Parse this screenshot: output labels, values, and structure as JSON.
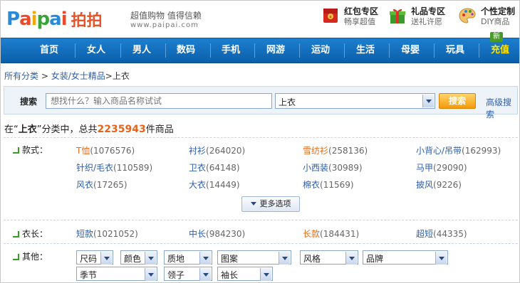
{
  "logo": {
    "en_letters": [
      "P",
      "a",
      "i",
      "p",
      "a",
      "i"
    ],
    "cn": "拍拍"
  },
  "slogan": {
    "line1": "超值购物 值得信赖",
    "url": "www.paipai.com"
  },
  "promos": [
    {
      "title": "红包专区",
      "sub": "畅享超值"
    },
    {
      "title": "礼品专区",
      "sub": "送礼许愿"
    },
    {
      "title": "个性定制",
      "sub": "DIY商品"
    }
  ],
  "nav": [
    "首页",
    "女人",
    "男人",
    "数码",
    "手机",
    "网游",
    "运动",
    "生活",
    "母婴",
    "玩具",
    "充值"
  ],
  "new_badge": "新",
  "breadcrumb": {
    "root": "所有分类",
    "sep1": ">",
    "cat": "女装/女士精品",
    "sep2": ">",
    "current": "上衣"
  },
  "search": {
    "label": "搜索",
    "placeholder": "想找什么？输入商品名称试试",
    "category": "上衣",
    "button": "搜索",
    "advanced": "高级搜索"
  },
  "result": {
    "prefix": "在“",
    "cat": "上衣",
    "mid": "”分类中，总共",
    "count": "2235943",
    "suffix": "件商品"
  },
  "filters": {
    "style_label": "款式：",
    "style_opts": [
      {
        "name": "T恤",
        "count": "(1076576)",
        "hl": true
      },
      {
        "name": "衬衫",
        "count": "(264020)",
        "hl": false
      },
      {
        "name": "雪纺衫",
        "count": "(258136)",
        "hl": true
      },
      {
        "name": "小背心/吊带",
        "count": "(162993)",
        "hl": false
      },
      {
        "name": "针织/毛衣",
        "count": "(110589)",
        "hl": false
      },
      {
        "name": "卫衣",
        "count": "(64148)",
        "hl": false
      },
      {
        "name": "小西装",
        "count": "(30989)",
        "hl": false
      },
      {
        "name": "马甲",
        "count": "(29090)",
        "hl": false
      },
      {
        "name": "风衣",
        "count": "(17265)",
        "hl": false
      },
      {
        "name": "大衣",
        "count": "(14449)",
        "hl": false
      },
      {
        "name": "棉衣",
        "count": "(11569)",
        "hl": false
      },
      {
        "name": "披风",
        "count": "(9226)",
        "hl": false
      }
    ],
    "more": "更多选项",
    "length_label": "衣长：",
    "length_opts": [
      {
        "name": "短款",
        "count": "(1021052)",
        "hl": false
      },
      {
        "name": "中长",
        "count": "(984230)",
        "hl": false
      },
      {
        "name": "长款",
        "count": "(184431)",
        "hl": true
      },
      {
        "name": "超短",
        "count": "(44335)",
        "hl": false
      }
    ],
    "other_label": "其他：",
    "other_selects": [
      "尺码",
      "颜色",
      "质地",
      "图案",
      "风格",
      "品牌",
      "季节",
      "领子",
      "袖长"
    ]
  },
  "colors": {
    "nav_bg": "#0b5fab",
    "accent_orange": "#e8641a",
    "link_blue": "#2d5ea8"
  },
  "icons": {
    "promo1": "red-envelope-icon",
    "promo2": "gift-box-icon",
    "promo3": "palette-icon"
  }
}
